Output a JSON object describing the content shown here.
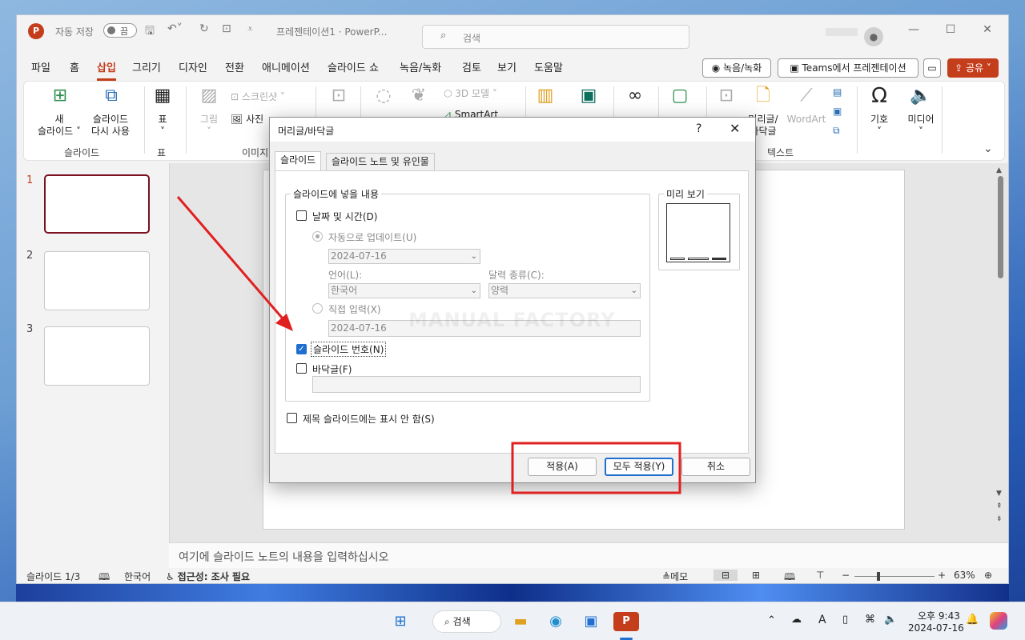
{
  "app": {
    "autosave_label": "자동 저장",
    "autosave_state": "끔",
    "doc_title": "프레젠테이션1 · PowerP...",
    "search_placeholder": "검색"
  },
  "menu": [
    "파일",
    "홈",
    "삽입",
    "그리기",
    "디자인",
    "전환",
    "애니메이션",
    "슬라이드 쇼",
    "녹음/녹화",
    "검토",
    "보기",
    "도움말"
  ],
  "menu_active": "삽입",
  "right_buttons": {
    "record": "녹음/녹화",
    "teams": "Teams에서 프레젠테이션",
    "share": "공유"
  },
  "ribbon": {
    "new_slide": [
      "새",
      "슬라이드 ˅"
    ],
    "reuse_slide": [
      "슬라이드",
      "다시 사용"
    ],
    "group_slides": "슬라이드",
    "table": "표",
    "group_table": "표",
    "image": "그림",
    "screenshot": "스크린샷 ˅",
    "photo_album": "사진",
    "group_images": "이미지",
    "three_d": "3D 모델",
    "smartart": "SmartArt",
    "header_footer": [
      "머리글/",
      "바닥글"
    ],
    "wordart": "WordArt",
    "symbol": "기호",
    "media": "미디어",
    "group_text": "텍스트"
  },
  "slides": [
    {
      "num": "1"
    },
    {
      "num": "2"
    },
    {
      "num": "3"
    }
  ],
  "notes_placeholder": "여기에 슬라이드 노트의 내용을 입력하십시오",
  "status": {
    "slide": "슬라이드 1/3",
    "language": "한국어",
    "accessibility": "접근성: 조사 필요",
    "notes": "메모",
    "zoom": "63%"
  },
  "dialog": {
    "title": "머리글/바닥글",
    "help": "?",
    "tabs": [
      "슬라이드",
      "슬라이드 노트 및 유인물"
    ],
    "group_content": "슬라이드에 넣을 내용",
    "date_time": "날짜 및 시간(D)",
    "auto_update": "자동으로 업데이트(U)",
    "auto_date": "2024-07-16",
    "language_label": "언어(L):",
    "language_value": "한국어",
    "calendar_label": "달력 종류(C):",
    "calendar_value": "양력",
    "fixed": "직접 입력(X)",
    "fixed_value": "2024-07-16",
    "slide_number": "슬라이드 번호(N)",
    "footer": "바닥글(F)",
    "dont_show_title": "제목 슬라이드에는 표시 안 함(S)",
    "preview_label": "미리 보기",
    "watermark": "MANUAL FACTORY",
    "apply": "적용(A)",
    "apply_all": "모두 적용(Y)",
    "cancel": "취소"
  },
  "taskbar": {
    "search": "검색",
    "time": "오후 9:43",
    "date": "2024-07-16"
  },
  "annotation_color": "#e02020"
}
